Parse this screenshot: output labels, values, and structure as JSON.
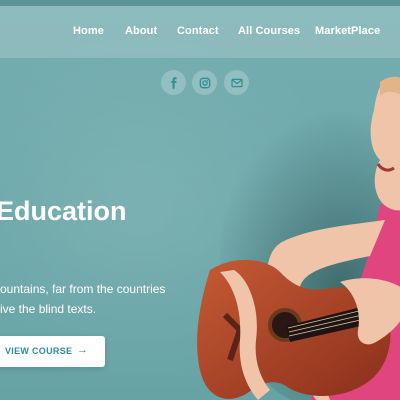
{
  "nav": {
    "items": [
      {
        "label": "Home"
      },
      {
        "label": "About"
      },
      {
        "label": "Contact"
      },
      {
        "label": "All Courses"
      },
      {
        "label": "MarketPlace"
      }
    ]
  },
  "social": {
    "icons": [
      "facebook-icon",
      "instagram-icon",
      "email-icon"
    ]
  },
  "hero": {
    "title": "Education",
    "text_line_1": "ountains, far from the countries",
    "text_line_2": "ive the blind texts.",
    "cta_label": "VIEW COURSE",
    "cta_arrow": "→"
  },
  "colors": {
    "background": "#6ea9ab",
    "accent": "#2e8f94",
    "guitar_body": "#b5482a",
    "shirt": "#e0457f"
  }
}
